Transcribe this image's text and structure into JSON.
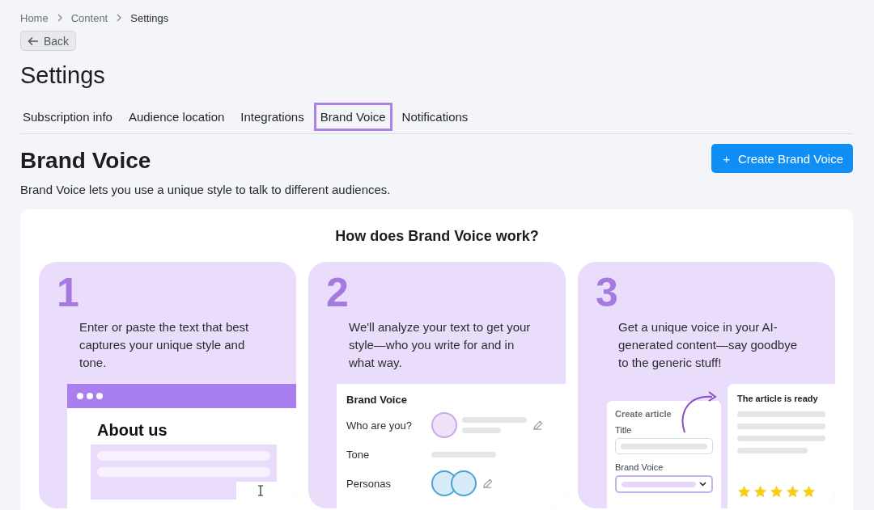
{
  "breadcrumb": [
    {
      "label": "Home"
    },
    {
      "label": "Content"
    },
    {
      "label": "Settings"
    }
  ],
  "back_button": "Back",
  "page_title": "Settings",
  "tabs": [
    {
      "label": "Subscription info",
      "selected": false
    },
    {
      "label": "Audience location",
      "selected": false
    },
    {
      "label": "Integrations",
      "selected": false
    },
    {
      "label": "Brand Voice",
      "selected": true
    },
    {
      "label": "Notifications",
      "selected": false
    }
  ],
  "section": {
    "title": "Brand Voice",
    "description": "Brand Voice lets you use a unique style to talk to different audiences.",
    "create_icon": "+",
    "create_button": "Create Brand Voice"
  },
  "how_it_works": {
    "heading": "How does Brand Voice work?",
    "steps": [
      {
        "number": "1",
        "text": "Enter or paste the text that best captures your unique style and tone.",
        "kind": "browser",
        "illustration": {
          "heading": "About us"
        }
      },
      {
        "number": "2",
        "text": "We'll analyze your text to get your style—who you write for and in what way.",
        "kind": "profile",
        "illustration": {
          "title": "Brand Voice",
          "rows": [
            {
              "label": "Who are you?",
              "kind": "avatar"
            },
            {
              "label": "Tone",
              "kind": "bar"
            },
            {
              "label": "Personas",
              "kind": "avatars"
            }
          ]
        }
      },
      {
        "number": "3",
        "text": "Get a unique voice in your AI-generated content—say goodbye to the generic stuff!",
        "kind": "article",
        "illustration": {
          "form_title": "Create article",
          "fields": [
            {
              "label": "Title",
              "kind": "text"
            },
            {
              "label": "Brand Voice",
              "kind": "select"
            }
          ],
          "result_title": "The article is ready",
          "stars": 5
        }
      }
    ]
  }
}
